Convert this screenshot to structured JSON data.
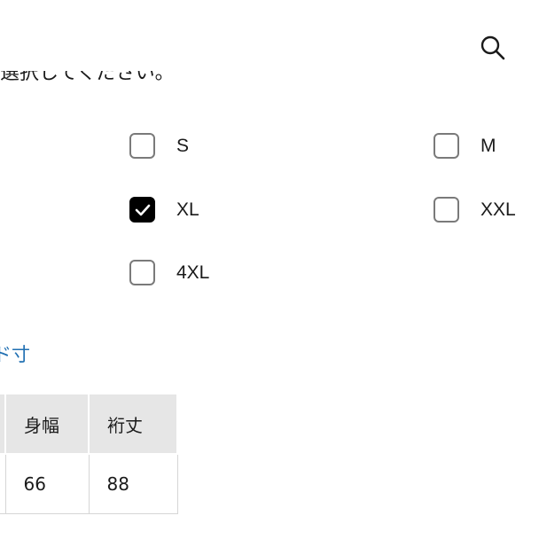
{
  "header": {
    "search_icon": "search-icon"
  },
  "prompt": {
    "text": "を選択してください。"
  },
  "size_options": [
    {
      "label": "S",
      "checked": false
    },
    {
      "label": "M",
      "checked": false
    },
    {
      "label": "XL",
      "checked": true
    },
    {
      "label": "XXL",
      "checked": false
    },
    {
      "label": "4XL",
      "checked": false
    }
  ],
  "size_link": {
    "label": "ド寸"
  },
  "size_table": {
    "headers": [
      "身幅",
      "裄丈"
    ],
    "rows": [
      [
        "66",
        "88"
      ]
    ]
  },
  "colors": {
    "link": "#1f6fb2",
    "checked": "#000000",
    "checkbox_border": "#7a7a7a",
    "table_header_bg": "#e6e6e6"
  }
}
